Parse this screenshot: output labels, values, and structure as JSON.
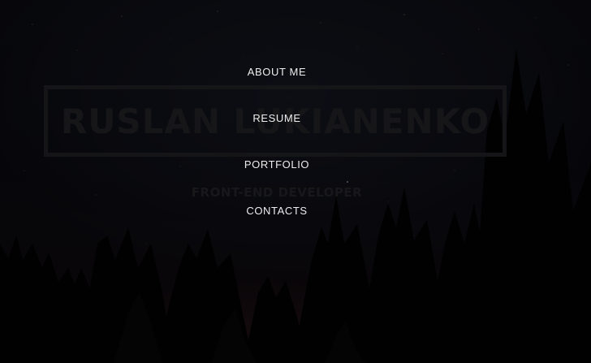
{
  "hero": {
    "name": "RUSLAN LUKIANENKO",
    "subtitle": "FRONT-END DEVELOPER"
  },
  "nav": {
    "items": [
      {
        "label": "ABOUT ME"
      },
      {
        "label": "RESUME"
      },
      {
        "label": "PORTFOLIO"
      },
      {
        "label": "CONTACTS"
      }
    ]
  },
  "colors": {
    "background": "#050507",
    "nav_text": "#ececec",
    "hero_text": "#232325"
  }
}
